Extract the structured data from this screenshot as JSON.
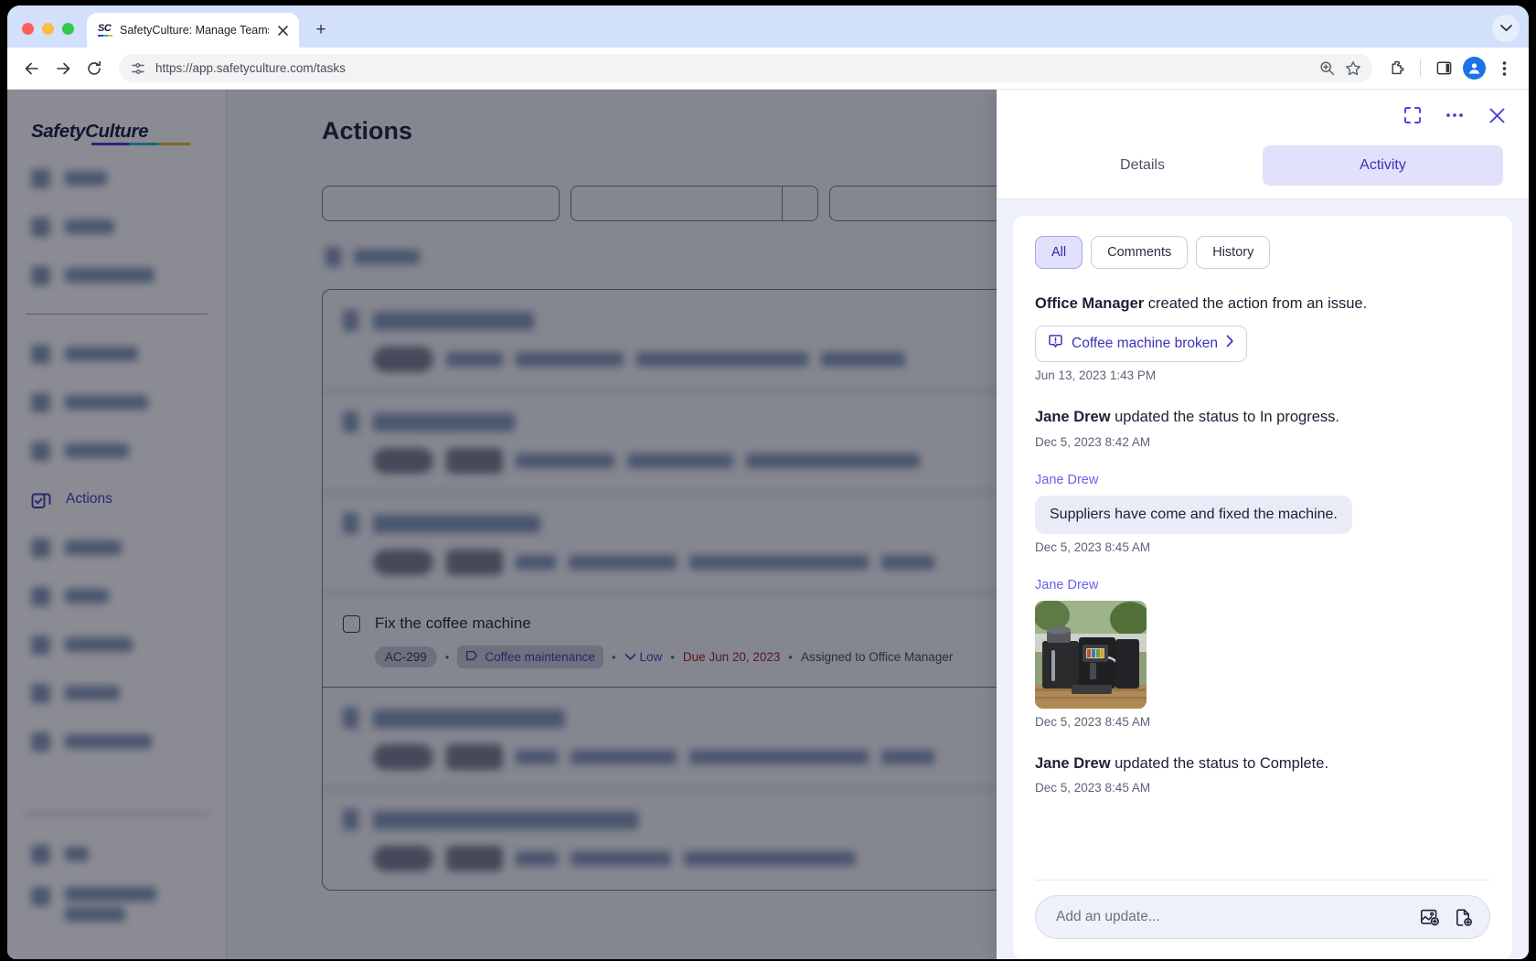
{
  "browser": {
    "tab": {
      "title": "SafetyCulture: Manage Teams and...",
      "favicon_text": "SC",
      "close_icon": "close-icon"
    },
    "new_tab_label": "+",
    "toolbar": {
      "back_icon": "back-arrow-icon",
      "forward_icon": "forward-arrow-icon",
      "reload_icon": "reload-icon",
      "site_info_icon": "site-settings-icon",
      "url": "https://app.safetyculture.com/tasks",
      "zoom_icon": "zoom-search-icon",
      "bookmark_icon": "star-icon",
      "extensions_icon": "extensions-puzzle-icon",
      "sidepanel_icon": "side-panel-icon",
      "profile_icon": "profile-avatar-icon",
      "menu_icon": "three-dot-menu-icon"
    },
    "tab_list_icon": "chevron-down-icon"
  },
  "app": {
    "brand": "SafetyCulture",
    "sidebar": {
      "active_item": "Actions",
      "actions_icon": "actions-stacked-check-icon"
    },
    "page_title": "Actions",
    "highlighted_task": {
      "title": "Fix the coffee machine",
      "code": "AC-299",
      "tag": "Coffee maintenance",
      "tag_icon": "tag-label-icon",
      "priority": "Low",
      "priority_icon": "chevron-down-icon",
      "due": "Due Jun 20, 2023",
      "assignee": "Assigned to Office Manager",
      "separator": "•"
    }
  },
  "panel": {
    "header": {
      "expand_icon": "expand-fullscreen-icon",
      "more_icon": "more-options-icon",
      "close_icon": "close-icon"
    },
    "tabs": [
      {
        "label": "Details",
        "active": false
      },
      {
        "label": "Activity",
        "active": true
      }
    ],
    "filters": [
      {
        "label": "All",
        "active": true
      },
      {
        "label": "Comments",
        "active": false
      },
      {
        "label": "History",
        "active": false
      }
    ],
    "entries": [
      {
        "type": "event",
        "actor": "Office Manager",
        "text": " created the action from an issue.",
        "chip": {
          "label": "Coffee machine broken",
          "icon": "issue-alert-icon",
          "chevron": "chevron-right-icon"
        },
        "time": "Jun 13, 2023 1:43 PM"
      },
      {
        "type": "event",
        "actor": "Jane Drew",
        "text": " updated the status to In progress.",
        "time": "Dec 5, 2023 8:42 AM"
      },
      {
        "type": "comment",
        "author": "Jane Drew",
        "message": "Suppliers have come and fixed the machine.",
        "time": "Dec 5, 2023 8:45 AM"
      },
      {
        "type": "photo",
        "author": "Jane Drew",
        "image_alt": "coffee-machine-photo",
        "time": "Dec 5, 2023 8:45 AM"
      },
      {
        "type": "event",
        "actor": "Jane Drew",
        "text": " updated the status to Complete.",
        "time": "Dec 5, 2023 8:45 AM"
      }
    ],
    "composer": {
      "placeholder": "Add an update...",
      "image_icon": "add-image-icon",
      "file_icon": "add-file-icon"
    }
  },
  "colors": {
    "accent": "#4a3ee0",
    "accent_soft": "#e2e1fb",
    "due_red": "#a3161d",
    "tab_strip": "#d2e0fb"
  }
}
